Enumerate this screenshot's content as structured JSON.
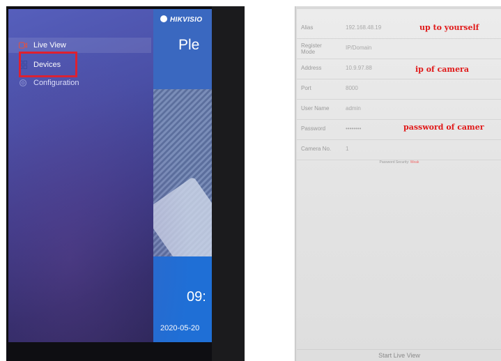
{
  "left_screen": {
    "logo_text": "HIKVISIO",
    "welcome_text": "Ple",
    "clock_text": "09:",
    "date_text": "2020-05-20",
    "menu_items": [
      {
        "label": "Live View",
        "icon": "live-view-icon"
      },
      {
        "label": "Devices",
        "icon": "devices-icon"
      },
      {
        "label": "Configuration",
        "icon": "gear-icon"
      }
    ],
    "highlight_color": "#e0202e"
  },
  "right_screen": {
    "fields": [
      {
        "label": "Alias",
        "value": "192.168.48.19"
      },
      {
        "label": "Register Mode",
        "value": "IP/Domain"
      },
      {
        "label": "Address",
        "value": "10.9.97.88"
      },
      {
        "label": "Port",
        "value": "8000"
      },
      {
        "label": "User Name",
        "value": "admin"
      },
      {
        "label": "Password",
        "value": "••••••••"
      },
      {
        "label": "Camera No.",
        "value": "1"
      }
    ],
    "password_security_label": "Password Security:",
    "password_security_value": "Weak",
    "start_live_view_label": "Start Live View",
    "annotations": {
      "alias": "up to yourself",
      "address": "ip of camera",
      "password": "password of camer"
    },
    "annotation_color": "#e01818"
  }
}
